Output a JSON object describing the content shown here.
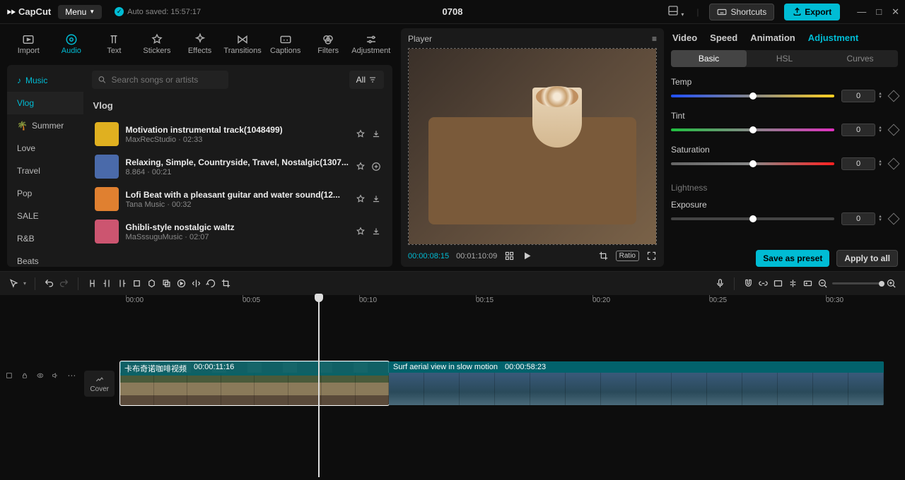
{
  "app": {
    "name": "CapCut",
    "menu": "Menu",
    "autosave": "Auto saved: 15:57:17",
    "project_title": "0708",
    "shortcuts": "Shortcuts",
    "export": "Export"
  },
  "asset_tabs": [
    "Import",
    "Audio",
    "Text",
    "Stickers",
    "Effects",
    "Transitions",
    "Captions",
    "Filters",
    "Adjustment"
  ],
  "music_sidebar": {
    "heading": "Music",
    "items": [
      "Vlog",
      "Summer",
      "Love",
      "Travel",
      "Pop",
      "SALE",
      "R&B",
      "Beats"
    ]
  },
  "search": {
    "placeholder": "Search songs or artists",
    "all": "All"
  },
  "section_title": "Vlog",
  "tracks": [
    {
      "title": "Motivation instrumental track(1048499)",
      "meta": "MaxRecStudio · 02:33",
      "thumb": "#e0b020"
    },
    {
      "title": "Relaxing, Simple, Countryside, Travel, Nostalgic(1307...",
      "meta": "8.864 · 00:21",
      "thumb": "#4a6aaa"
    },
    {
      "title": "Lofi Beat with a pleasant guitar and water sound(12...",
      "meta": "Tana Music · 00:32",
      "thumb": "#e08030"
    },
    {
      "title": "Ghibli-style nostalgic waltz",
      "meta": "MaSssuguMusic · 02:07",
      "thumb": "#cc5570"
    }
  ],
  "player": {
    "title": "Player",
    "current": "00:00:08:15",
    "total": "00:01:10:09",
    "ratio": "Ratio"
  },
  "adjust_tabs": [
    "Video",
    "Speed",
    "Animation",
    "Adjustment"
  ],
  "adjust_subtabs": [
    "Basic",
    "HSL",
    "Curves"
  ],
  "sliders": {
    "temp": {
      "label": "Temp",
      "value": "0",
      "gradient": "linear-gradient(90deg,#2050ff,#888,#ffd020)"
    },
    "tint": {
      "label": "Tint",
      "value": "0",
      "gradient": "linear-gradient(90deg,#20c040,#888,#e030c0)"
    },
    "saturation": {
      "label": "Saturation",
      "value": "0",
      "gradient": "linear-gradient(90deg,#666,#888,#ff2020)"
    },
    "exposure": {
      "label": "Exposure",
      "value": "0",
      "gradient": "#444"
    }
  },
  "lightness": "Lightness",
  "save_preset": "Save as preset",
  "apply_all": "Apply to all",
  "ruler": [
    "00:00",
    "00:05",
    "00:10",
    "00:15",
    "00:20",
    "00:25",
    "00:30"
  ],
  "cover": "Cover",
  "clips": [
    {
      "name": "卡布奇诺咖啡视频",
      "duration": "00:00:11:16"
    },
    {
      "name": "Surf aerial view in slow motion",
      "duration": "00:00:58:23"
    }
  ]
}
